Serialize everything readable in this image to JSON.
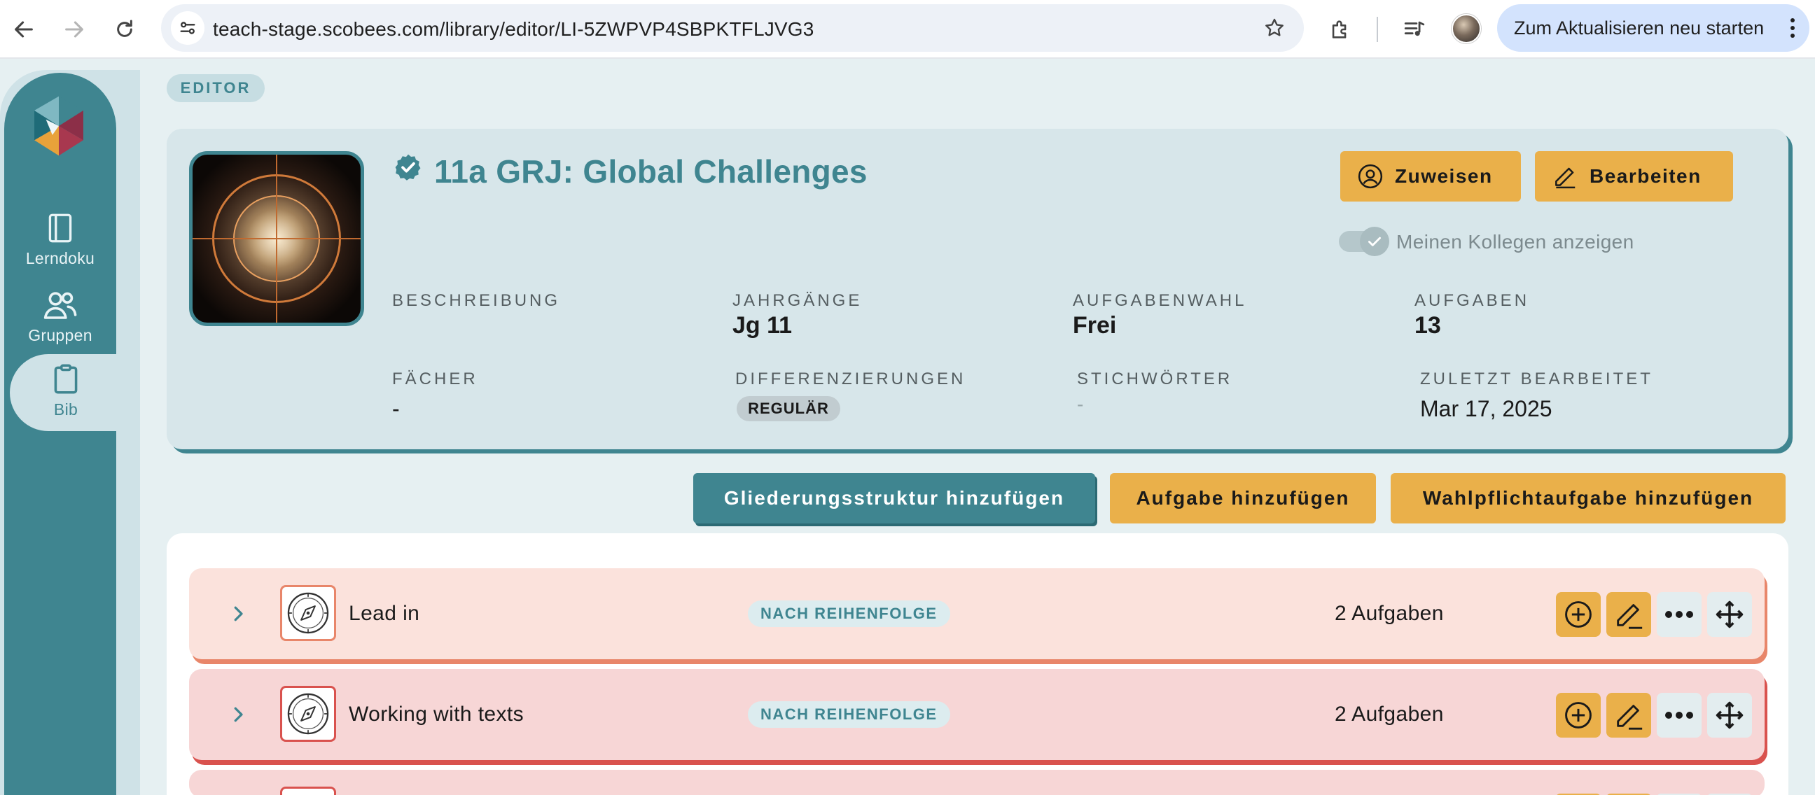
{
  "browser": {
    "url": "teach-stage.scobees.com/library/editor/LI-5ZWPVP4SBPKTFLJVG3",
    "update_button": "Zum Aktualisieren neu starten"
  },
  "sidebar": {
    "items": [
      {
        "label": "Lerndoku",
        "icon": "notebook-icon"
      },
      {
        "label": "Gruppen",
        "icon": "users-icon"
      },
      {
        "label": "Bib",
        "icon": "clipboard-icon",
        "active": true
      }
    ]
  },
  "editor": {
    "chip": "EDITOR",
    "title": "11a GRJ: Global Challenges",
    "assign_button": "Zuweisen",
    "edit_button": "Bearbeiten",
    "show_colleagues_label": "Meinen Kollegen anzeigen",
    "show_colleagues_enabled": true,
    "meta": {
      "beschreibung_label": "BESCHREIBUNG",
      "jahrgaenge_label": "JAHRGÄNGE",
      "jahrgaenge_value": "Jg 11",
      "aufgabenwahl_label": "AUFGABENWAHL",
      "aufgabenwahl_value": "Frei",
      "aufgaben_label": "AUFGABEN",
      "aufgaben_value": "13",
      "faecher_label": "FÄCHER",
      "faecher_value": "-",
      "differenzierungen_label": "DIFFERENZIERUNGEN",
      "differenzierungen_value": "REGULÄR",
      "stichwoerter_label": "STICHWÖRTER",
      "stichwoerter_value": "-",
      "zuletzt_label": "ZULETZT BEARBEITET",
      "zuletzt_value": "Mar 17, 2025"
    }
  },
  "actions": {
    "add_structure": "Gliederungsstruktur hinzufügen",
    "add_task": "Aufgabe hinzufügen",
    "add_elective": "Wahlpflichtaufgabe hinzufügen"
  },
  "sections": [
    {
      "name": "Lead in",
      "order": "NACH REIHENFOLGE",
      "count": "2 Aufgaben",
      "accent": "#e8866a"
    },
    {
      "name": "Working with texts",
      "order": "NACH REIHENFOLGE",
      "count": "2 Aufgaben",
      "accent": "#d9524e"
    }
  ],
  "colors": {
    "teal": "#3f8590",
    "orange": "#eab04a",
    "card_bg": "#d7e6ea"
  }
}
